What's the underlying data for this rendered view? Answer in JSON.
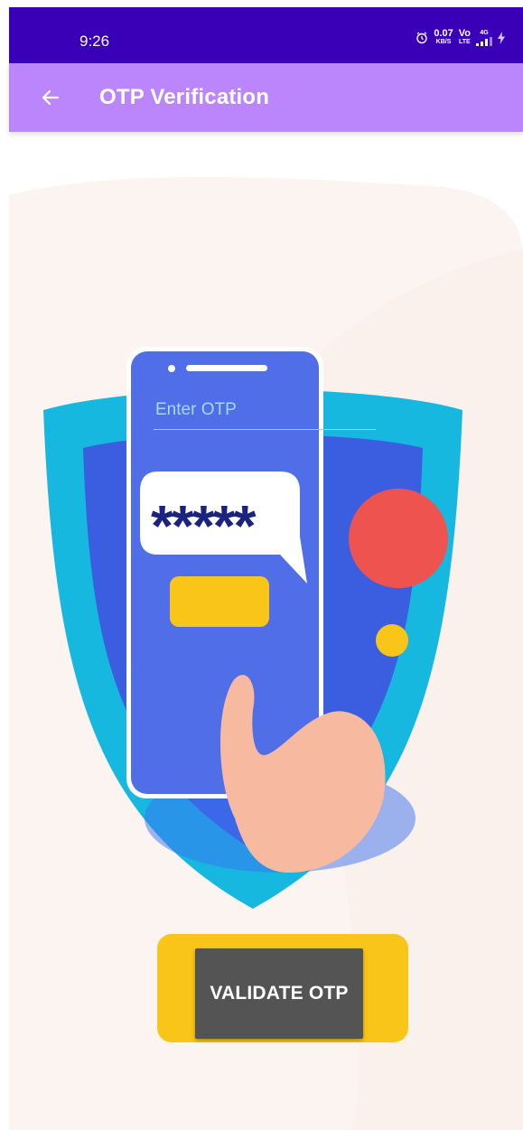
{
  "status_bar": {
    "time": "9:26",
    "net_speed_value": "0.07",
    "net_speed_unit": "KB/S",
    "volte_top": "Vo",
    "volte_bottom": "LTE",
    "network": "4G"
  },
  "app_bar": {
    "title": "OTP Verification",
    "back_icon": "arrow-left-icon"
  },
  "otp": {
    "placeholder": "Enter OTP",
    "masked_code": "*****"
  },
  "validate_button": {
    "label": "VALIDATE OTP"
  },
  "colors": {
    "status_bar": "#3a00b8",
    "app_bar": "#bb86fc",
    "button": "#545454",
    "shield_outer": "#16b8e0",
    "phone": "#4f6ee8",
    "accent_yellow": "#f9c518",
    "accent_red": "#ef5350"
  }
}
